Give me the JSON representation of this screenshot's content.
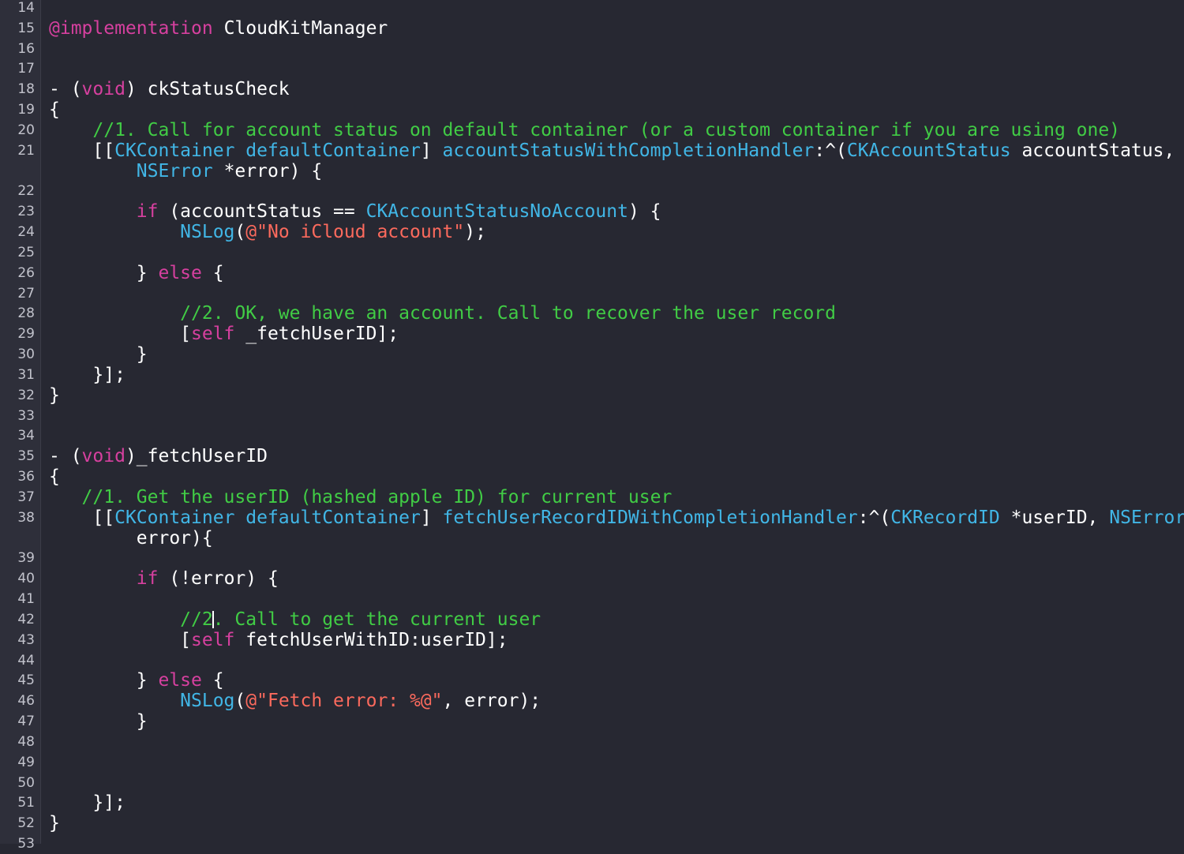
{
  "editor": {
    "lines": [
      {
        "n": "14",
        "t": []
      },
      {
        "n": "15",
        "t": [
          [
            "kw",
            "@implementation"
          ],
          [
            "tx",
            " CloudKitManager"
          ]
        ]
      },
      {
        "n": "16",
        "t": []
      },
      {
        "n": "17",
        "t": []
      },
      {
        "n": "18",
        "t": [
          [
            "tx",
            "- ("
          ],
          [
            "kw",
            "void"
          ],
          [
            "tx",
            ") ckStatusCheck"
          ]
        ]
      },
      {
        "n": "19",
        "t": [
          [
            "tx",
            "{"
          ]
        ]
      },
      {
        "n": "20",
        "t": [
          [
            "tx",
            "    "
          ],
          [
            "cm",
            "//1. Call for account status on default container (or a custom container if you are using one)"
          ]
        ]
      },
      {
        "n": "21",
        "t": [
          [
            "tx",
            "    [["
          ],
          [
            "ty",
            "CKContainer defaultContainer"
          ],
          [
            "tx",
            "] "
          ],
          [
            "ty",
            "accountStatusWithCompletionHandler"
          ],
          [
            "tx",
            ":^("
          ],
          [
            "ty",
            "CKAccountStatus"
          ],
          [
            "tx",
            " accountStatus,"
          ]
        ]
      },
      {
        "n": "",
        "t": [
          [
            "tx",
            "        "
          ],
          [
            "ty",
            "NSError"
          ],
          [
            "tx",
            " *error) {"
          ]
        ]
      },
      {
        "n": "22",
        "t": []
      },
      {
        "n": "23",
        "t": [
          [
            "tx",
            "        "
          ],
          [
            "kw",
            "if"
          ],
          [
            "tx",
            " (accountStatus == "
          ],
          [
            "ty",
            "CKAccountStatusNoAccount"
          ],
          [
            "tx",
            ") {"
          ]
        ]
      },
      {
        "n": "24",
        "t": [
          [
            "tx",
            "            "
          ],
          [
            "ty",
            "NSLog"
          ],
          [
            "tx",
            "("
          ],
          [
            "st",
            "@\"No iCloud account\""
          ],
          [
            "tx",
            ");"
          ]
        ]
      },
      {
        "n": "25",
        "t": []
      },
      {
        "n": "26",
        "t": [
          [
            "tx",
            "        } "
          ],
          [
            "kw",
            "else"
          ],
          [
            "tx",
            " {"
          ]
        ]
      },
      {
        "n": "27",
        "t": []
      },
      {
        "n": "28",
        "t": [
          [
            "tx",
            "            "
          ],
          [
            "cm",
            "//2. OK, we have an account. Call to recover the user record"
          ]
        ]
      },
      {
        "n": "29",
        "t": [
          [
            "tx",
            "            ["
          ],
          [
            "kw",
            "self"
          ],
          [
            "tx",
            " _fetchUserID];"
          ]
        ]
      },
      {
        "n": "30",
        "t": [
          [
            "tx",
            "        }"
          ]
        ]
      },
      {
        "n": "31",
        "t": [
          [
            "tx",
            "    }];"
          ]
        ]
      },
      {
        "n": "32",
        "t": [
          [
            "tx",
            "}"
          ]
        ]
      },
      {
        "n": "33",
        "t": []
      },
      {
        "n": "34",
        "t": []
      },
      {
        "n": "35",
        "t": [
          [
            "tx",
            "- ("
          ],
          [
            "kw",
            "void"
          ],
          [
            "tx",
            ")_fetchUserID"
          ]
        ]
      },
      {
        "n": "36",
        "t": [
          [
            "tx",
            "{"
          ]
        ]
      },
      {
        "n": "37",
        "t": [
          [
            "tx",
            "   "
          ],
          [
            "cm",
            "//1. Get the userID (hashed apple ID) for current user"
          ]
        ]
      },
      {
        "n": "38",
        "t": [
          [
            "tx",
            "    [["
          ],
          [
            "ty",
            "CKContainer defaultContainer"
          ],
          [
            "tx",
            "] "
          ],
          [
            "ty",
            "fetchUserRecordIDWithCompletionHandler"
          ],
          [
            "tx",
            ":^("
          ],
          [
            "ty",
            "CKRecordID"
          ],
          [
            "tx",
            " *userID, "
          ],
          [
            "ty",
            "NSError"
          ],
          [
            "tx",
            " *"
          ]
        ]
      },
      {
        "n": "",
        "t": [
          [
            "tx",
            "        error){"
          ]
        ]
      },
      {
        "n": "39",
        "t": []
      },
      {
        "n": "40",
        "t": [
          [
            "tx",
            "        "
          ],
          [
            "kw",
            "if"
          ],
          [
            "tx",
            " (!error) {"
          ]
        ]
      },
      {
        "n": "41",
        "t": []
      },
      {
        "n": "42",
        "t": [
          [
            "tx",
            "            "
          ],
          [
            "cm",
            "//2"
          ],
          [
            "caret",
            ""
          ],
          [
            "cm",
            ". Call to get the current user"
          ]
        ]
      },
      {
        "n": "43",
        "t": [
          [
            "tx",
            "            ["
          ],
          [
            "kw",
            "self"
          ],
          [
            "tx",
            " fetchUserWithID:userID];"
          ]
        ]
      },
      {
        "n": "44",
        "t": []
      },
      {
        "n": "45",
        "t": [
          [
            "tx",
            "        } "
          ],
          [
            "kw",
            "else"
          ],
          [
            "tx",
            " {"
          ]
        ]
      },
      {
        "n": "46",
        "t": [
          [
            "tx",
            "            "
          ],
          [
            "ty",
            "NSLog"
          ],
          [
            "tx",
            "("
          ],
          [
            "st",
            "@\"Fetch error: %@\""
          ],
          [
            "tx",
            ", error);"
          ]
        ]
      },
      {
        "n": "47",
        "t": [
          [
            "tx",
            "        }"
          ]
        ]
      },
      {
        "n": "48",
        "t": []
      },
      {
        "n": "49",
        "t": []
      },
      {
        "n": "50",
        "t": []
      },
      {
        "n": "51",
        "t": [
          [
            "tx",
            "    }];"
          ]
        ]
      },
      {
        "n": "52",
        "t": [
          [
            "tx",
            "}"
          ]
        ]
      },
      {
        "n": "53",
        "t": []
      }
    ]
  }
}
